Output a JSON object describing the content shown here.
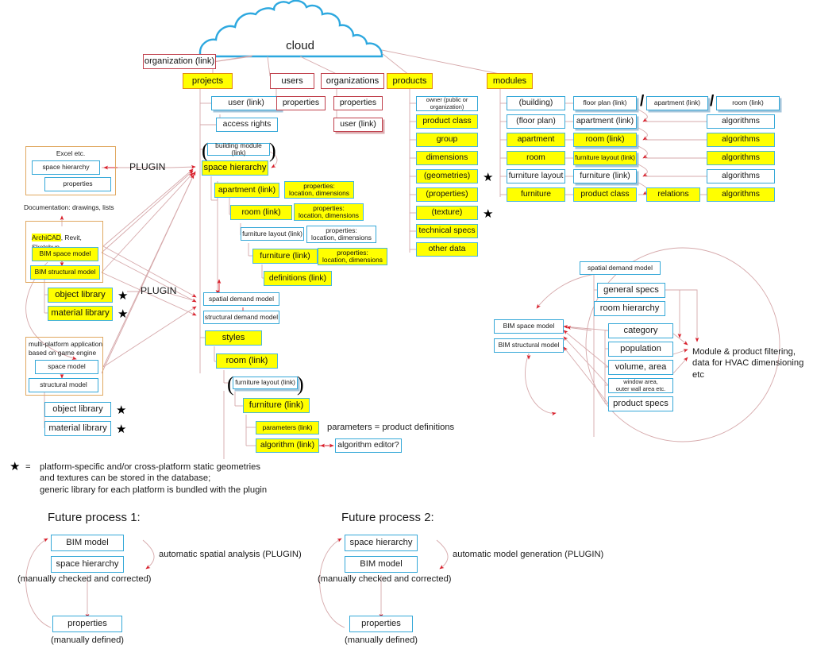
{
  "diagram": {
    "title_node": "cloud",
    "colors": {
      "cloud_stroke": "#2da8df",
      "blue_border": "#35a8d8",
      "yellow_fill": "#ffff00",
      "orange_border": "#e08a12",
      "red_border": "#c0404c",
      "connector": "#c98f92",
      "arrow_head": "#d9202c",
      "group_border": "#e0a860"
    }
  },
  "cloud": {
    "label": "cloud"
  },
  "top_level": {
    "organization_link": "organization (link)",
    "projects": "projects",
    "users": "users",
    "organizations": "organizations",
    "products": "products",
    "modules": "modules"
  },
  "projects_branch": {
    "user_link": "user (link)",
    "access_rights": "access rights",
    "building_module_link": "building module (link)",
    "space_hierarchy": "space hierarchy",
    "apartment_link": "apartment (link)",
    "room_link": "room (link)",
    "furniture_layout_link": "furniture layout (link)",
    "furniture_link": "furniture (link)",
    "definitions_link": "definitions (link)",
    "properties_note": "properties:\nlocation, dimensions",
    "spatial_demand_model": "spatial demand model",
    "structural_demand_model": "structural demand model",
    "styles": "styles",
    "styles_room_link": "room (link)",
    "styles_furniture_layout_link": "furniture layout (link)",
    "styles_furniture_link": "furniture (link)",
    "parameters_link": "parameters (link)",
    "algorithm_link": "algorithm (link)",
    "algorithm_editor": "algorithm editor?",
    "parameters_note": "parameters = product definitions"
  },
  "users_branch": {
    "properties": "properties"
  },
  "organizations_branch": {
    "properties": "properties",
    "user_link": "user (link)"
  },
  "products_branch": {
    "items": [
      "owner (public or\norganization)",
      "product class",
      "group",
      "dimensions",
      "(geometries)",
      "(properties)",
      "(texture)",
      "technical specs",
      "other data"
    ]
  },
  "modules_branch": {
    "col1": [
      "(building)",
      "(floor plan)",
      "apartment",
      "room",
      "furniture layout",
      "furniture"
    ],
    "col2": [
      "floor plan (link)",
      "apartment (link)",
      "room (link)",
      "furniture layout (link)",
      "furniture (link)",
      "product class"
    ],
    "col3_header": "apartment (link)",
    "col3_relations": "relations",
    "col4_header": "room (link)",
    "col4_algorithms": [
      "algorithms",
      "algorithms",
      "algorithms",
      "algorithms",
      "algorithms"
    ],
    "separator": "/"
  },
  "left_panels": {
    "excel": {
      "title": "Excel etc.",
      "space_hierarchy": "space hierarchy",
      "properties": "properties"
    },
    "documentation_note": "Documentation: drawings, lists",
    "bim": {
      "title": "ArchiCAD, Revit,\nSketchup",
      "title_highlight": "ArchiCAD",
      "space_model": "BIM space model",
      "structural_model": "BIM structural model",
      "object_library": "object library",
      "material_library": "material library"
    },
    "gameengine": {
      "title": "multi-platform application\nbased on game engine",
      "space_model": "space model",
      "structural_model": "structural model",
      "object_library": "object library",
      "material_library": "material library"
    },
    "plugin_top": "PLUGIN",
    "plugin_bottom": "PLUGIN"
  },
  "circle_cluster": {
    "spatial_demand_model": "spatial demand model",
    "general_specs": "general specs",
    "room_hierarchy": "room hierarchy",
    "category": "category",
    "population": "population",
    "volume_area": "volume, area",
    "window_area": "window area,\nouter wall area etc.",
    "product_specs": "product specs",
    "bim_space_model": "BIM space model",
    "bim_structural_model": "BIM structural model",
    "filtering_note": "Module & product filtering,\ndata for HVAC dimensioning etc"
  },
  "footnote": {
    "symbol": "★",
    "equals": "=",
    "text": "platform-specific and/or cross-platform static geometries\nand textures can be stored in the database;\ngeneric library for each platform is bundled with the plugin"
  },
  "future_process_1": {
    "title": "Future process 1:",
    "bim_model": "BIM model",
    "space_hierarchy": "space hierarchy",
    "manually_checked": "(manually checked and corrected)",
    "properties": "properties",
    "manually_defined": "(manually defined)",
    "arrow_note": "automatic spatial analysis (PLUGIN)"
  },
  "future_process_2": {
    "title": "Future process 2:",
    "space_hierarchy": "space hierarchy",
    "bim_model": "BIM model",
    "manually_checked": "(manually checked and corrected)",
    "properties": "properties",
    "manually_defined": "(manually defined)",
    "arrow_note": "automatic model generation (PLUGIN)"
  }
}
